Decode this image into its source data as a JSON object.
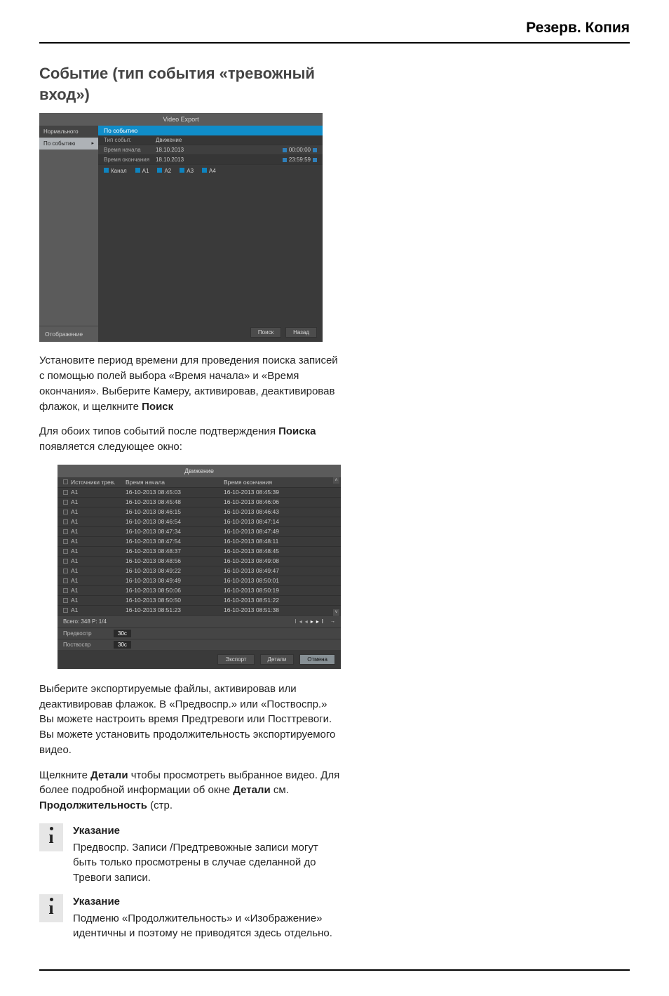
{
  "header": {
    "title": "Резерв. Копия"
  },
  "heading": "Событие (тип события «тревожный вход»)",
  "shot1": {
    "window_title": "Video Export",
    "side_items": [
      "Нормального",
      "По событию"
    ],
    "tab": "По событию",
    "rows": {
      "r1_label": "Тип событ.",
      "r1_value": "Движение",
      "r2_label": "Время начала",
      "r2_date": "18.10.2013",
      "r2_time": "00:00:00",
      "r3_label": "Время окончания",
      "r3_date": "18.10.2013",
      "r3_time": "23:59:59"
    },
    "chan": {
      "main": "Канал",
      "a1": "A1",
      "a2": "A2",
      "a3": "A3",
      "a4": "A4"
    },
    "btn_search": "Поиск",
    "btn_back": "Назад",
    "footer": "Отображение"
  },
  "para1_a": "Установите период времени для проведения поиска записей с помощью полей выбора «Время начала» и «Время окончания». Выберите Камеру, активировав, деактивировав флажок, и щелкните ",
  "para1_b": "Поиск",
  "para2_a": "Для обоих типов событий после подтверждения ",
  "para2_b": "Поиска",
  "para2_c": " появляется следующее окно:",
  "shot2": {
    "title": "Движение",
    "head": {
      "src": "Источники трев.",
      "start": "Время начала",
      "end": "Время окончания"
    },
    "rows": [
      {
        "src": "A1",
        "start": "16-10-2013 08:45:03",
        "end": "16-10-2013 08:45:39"
      },
      {
        "src": "A1",
        "start": "16-10-2013 08:45:48",
        "end": "16-10-2013 08:46:06"
      },
      {
        "src": "A1",
        "start": "16-10-2013 08:46:15",
        "end": "16-10-2013 08:46:43"
      },
      {
        "src": "A1",
        "start": "16-10-2013 08:46:54",
        "end": "16-10-2013 08:47:14"
      },
      {
        "src": "A1",
        "start": "16-10-2013 08:47:34",
        "end": "16-10-2013 08:47:49"
      },
      {
        "src": "A1",
        "start": "16-10-2013 08:47:54",
        "end": "16-10-2013 08:48:11"
      },
      {
        "src": "A1",
        "start": "16-10-2013 08:48:37",
        "end": "16-10-2013 08:48:45"
      },
      {
        "src": "A1",
        "start": "16-10-2013 08:48:56",
        "end": "16-10-2013 08:49:08"
      },
      {
        "src": "A1",
        "start": "16-10-2013 08:49:22",
        "end": "16-10-2013 08:49:47"
      },
      {
        "src": "A1",
        "start": "16-10-2013 08:49:49",
        "end": "16-10-2013 08:50:01"
      },
      {
        "src": "A1",
        "start": "16-10-2013 08:50:06",
        "end": "16-10-2013 08:50:19"
      },
      {
        "src": "A1",
        "start": "16-10-2013 08:50:50",
        "end": "16-10-2013 08:51:22"
      },
      {
        "src": "A1",
        "start": "16-10-2013 08:51:23",
        "end": "16-10-2013 08:51:38"
      }
    ],
    "pager_text": "Всего: 348  P: 1/4",
    "pre_label": "Предвоспр",
    "pre_value": "30с",
    "post_label": "Поствоспр",
    "post_value": "30с",
    "btn_export": "Экспорт",
    "btn_details": "Детали",
    "btn_cancel": "Отмена"
  },
  "para3": "Выберите экспортируемые файлы, активировав или деактивировав флажок. В «Предвоспр.» или «Поствоспр.» Вы можете настроить время Предтревоги или Посттревоги. Вы можете установить продолжительность экспортируемого видео.",
  "para4_a": "Щелкните ",
  "para4_b": "Детали",
  "para4_c": " чтобы просмотреть выбранное видео. Для более подробной информации об окне ",
  "para4_d": "Детали",
  "para4_e": " см. ",
  "para4_f": "Продолжительность",
  "para4_g": " (стр.",
  "info1": {
    "title": "Указание",
    "body": "Предвоспр. Записи /Предтревожные записи могут быть только просмотрены в случае сделанной до Тревоги записи."
  },
  "info2": {
    "title": "Указание",
    "body": "Подменю «Продолжительность» и «Изображение» идентичны и поэтому не приводятся здесь отдельно."
  }
}
